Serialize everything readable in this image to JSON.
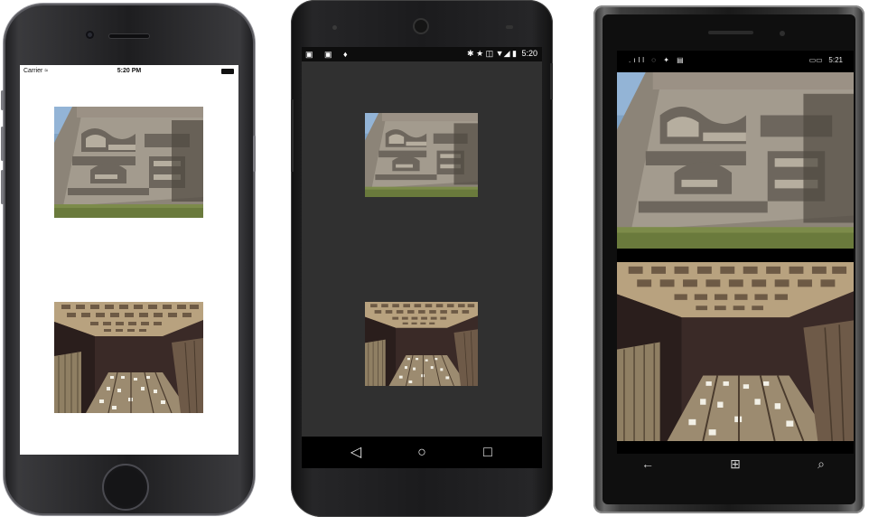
{
  "iphone": {
    "carrier": "Carrier",
    "wifi_icon": "wifi-icon",
    "time": "5:20 PM"
  },
  "android": {
    "status_left_icons": "▣ ▣ ♦",
    "status_right_icons": "✱ ★ ◫ ▼◢ ▮",
    "time": "5:20",
    "nav": {
      "back": "◁",
      "home": "○",
      "recents": "□"
    }
  },
  "windows_phone": {
    "status_left_icons": ".ıll ◌ ✦ ▤",
    "status_right_icons": "▭▭",
    "time": "5:21",
    "nav": {
      "back": "←",
      "start": "⊞",
      "search": "⌕"
    }
  },
  "photos": {
    "image1": "stone-carving-photo",
    "image2": "waffle-ceiling-photo"
  },
  "colors": {
    "android_screen_bg": "#303030",
    "ios_screen_bg": "#ffffff",
    "wp_screen_bg": "#000000"
  }
}
